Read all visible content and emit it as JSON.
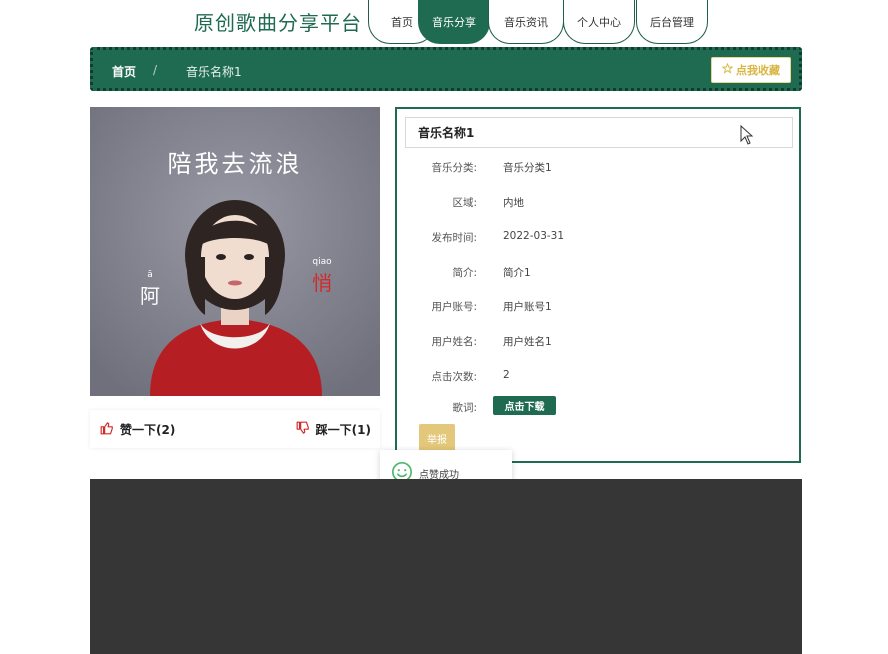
{
  "header": {
    "site_title": "原创歌曲分享平台",
    "nav": [
      {
        "label": "首页",
        "active": false
      },
      {
        "label": "音乐分享",
        "active": true
      },
      {
        "label": "音乐资讯",
        "active": false
      },
      {
        "label": "个人中心",
        "active": false
      },
      {
        "label": "后台管理",
        "active": false
      }
    ]
  },
  "breadcrumb": {
    "home": "首页",
    "separator": "/",
    "current": "音乐名称1",
    "favorite_label": "点我收藏"
  },
  "cover": {
    "title": "陪我去流浪",
    "artist_char1": "阿",
    "artist_pinyin1": "ā",
    "artist_char2": "悄",
    "artist_pinyin2": "qiao"
  },
  "votes": {
    "like_label": "赞一下(2)",
    "dislike_label": "踩一下(1)"
  },
  "detail": {
    "title": "音乐名称1",
    "fields": [
      {
        "label": "音乐分类:",
        "value": "音乐分类1"
      },
      {
        "label": "区域:",
        "value": "内地"
      },
      {
        "label": "发布时间:",
        "value": "2022-03-31"
      },
      {
        "label": "简介:",
        "value": "简介1"
      },
      {
        "label": "用户账号:",
        "value": "用户账号1"
      },
      {
        "label": "用户姓名:",
        "value": "用户姓名1"
      },
      {
        "label": "点击次数:",
        "value": "2"
      }
    ],
    "lyrics_label": "歌词:",
    "download_label": "点击下载",
    "report_label": "举报"
  },
  "toast": {
    "message": "点赞成功"
  },
  "colors": {
    "primary": "#1f6b52",
    "favorite": "#d8b640",
    "report": "#e3c77a",
    "footer": "#363636"
  }
}
